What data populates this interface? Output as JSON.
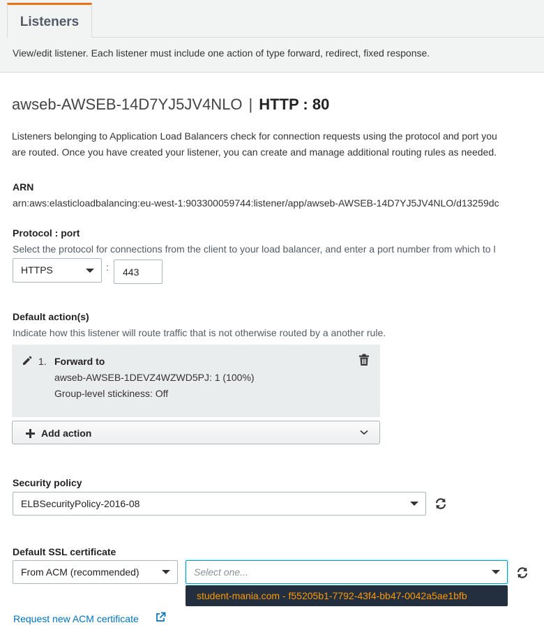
{
  "tabs": {
    "active": "Listeners",
    "description": "View/edit listener. Each listener must include one action of type forward, redirect, fixed response."
  },
  "header": {
    "load_balancer": "awseb-AWSEB-14D7YJ5JV4NLO",
    "separator": "|",
    "listener": "HTTP : 80"
  },
  "intro": {
    "line1": "Listeners belonging to Application Load Balancers check for connection requests using the protocol and port you",
    "line2": "are routed. Once you have created your listener, you can create and manage additional routing rules as needed."
  },
  "arn": {
    "label": "ARN",
    "value": "arn:aws:elasticloadbalancing:eu-west-1:903300059744:listener/app/awseb-AWSEB-14D7YJ5JV4NLO/d13259dc"
  },
  "protocol": {
    "label": "Protocol : port",
    "help": "Select the protocol for connections from the client to your load balancer, and enter a port number from which to l",
    "selected": "HTTPS",
    "colon": ":",
    "port": "443"
  },
  "default_actions": {
    "label": "Default action(s)",
    "help": "Indicate how this listener will route traffic that is not otherwise routed by a another rule.",
    "items": [
      {
        "number": "1.",
        "title": "Forward to",
        "target": "awseb-AWSEB-1DEVZ4WZWD5PJ: 1 (100%)",
        "stickiness": "Group-level stickiness: Off"
      }
    ],
    "add_label": "Add action"
  },
  "security_policy": {
    "label": "Security policy",
    "selected": "ELBSecurityPolicy-2016-08"
  },
  "ssl": {
    "label": "Default SSL certificate",
    "source_selected": "From ACM (recommended)",
    "cert_placeholder": "Select one...",
    "dropdown_option": "student-mania.com - f55205b1-7792-43f4-bb47-0042a5ae1bfb",
    "request_link": "Request new ACM certificate"
  },
  "colors": {
    "accent_tab": "#ec7211",
    "link": "#0073bb",
    "focus_border": "#00a1c9",
    "dropdown_bg": "#232f3e",
    "dropdown_text": "#ff9900"
  },
  "icons": [
    "pencil-icon",
    "trash-icon",
    "plus-icon",
    "chevron-down-icon",
    "refresh-icon",
    "external-link-icon"
  ]
}
